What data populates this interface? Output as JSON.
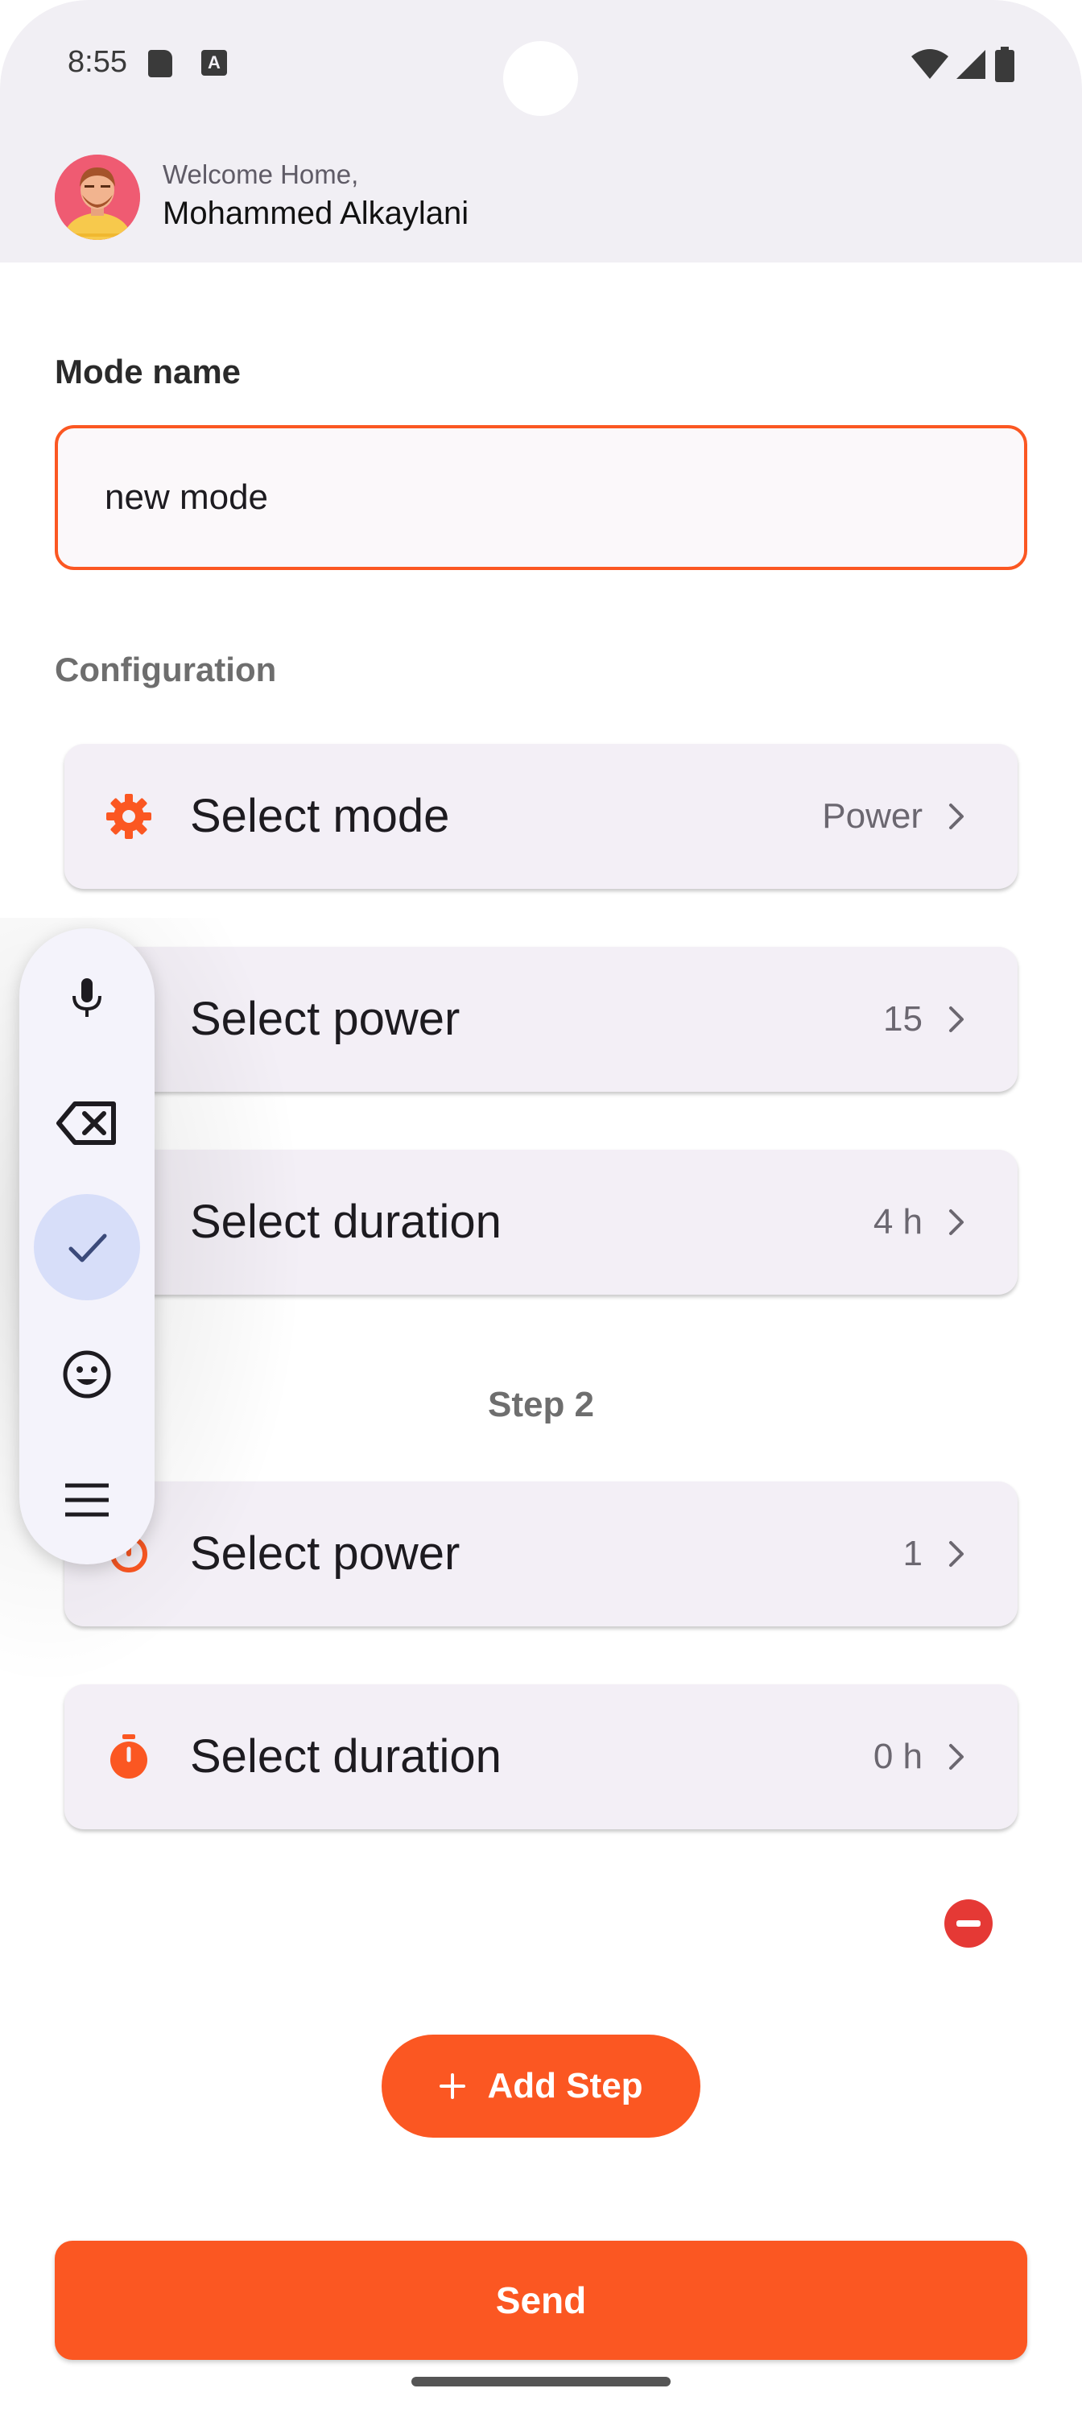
{
  "status_bar": {
    "time": "8:55",
    "icons": [
      "sd-card-icon",
      "text-a-icon",
      "wifi-icon",
      "signal-icon",
      "battery-icon"
    ]
  },
  "header": {
    "welcome": "Welcome Home,",
    "user_name": "Mohammed Alkaylani"
  },
  "form": {
    "mode_name_label": "Mode name",
    "mode_name_value": "new mode",
    "configuration_label": "Configuration"
  },
  "step1": {
    "items": [
      {
        "title": "Select mode",
        "value": "Power",
        "icon": "gear-icon"
      },
      {
        "title": "Select power",
        "value": "15",
        "icon": "power-icon"
      },
      {
        "title": "Select duration",
        "value": "4 h",
        "icon": "timer-icon"
      }
    ]
  },
  "step2": {
    "label": "Step 2",
    "items": [
      {
        "title": "Select power",
        "value": "1",
        "icon": "power-icon"
      },
      {
        "title": "Select duration",
        "value": "0 h",
        "icon": "timer-icon"
      }
    ]
  },
  "actions": {
    "add_step": "Add Step",
    "send": "Send"
  },
  "floating_toolbar": {
    "items": [
      "microphone-icon",
      "backspace-icon",
      "check-icon",
      "emoji-icon",
      "menu-icon"
    ],
    "active_item": "check-icon"
  },
  "colors": {
    "accent": "#fb5722",
    "card_bg": "#f3eff6",
    "header_bg": "#f1eff4",
    "danger": "#e53935"
  }
}
